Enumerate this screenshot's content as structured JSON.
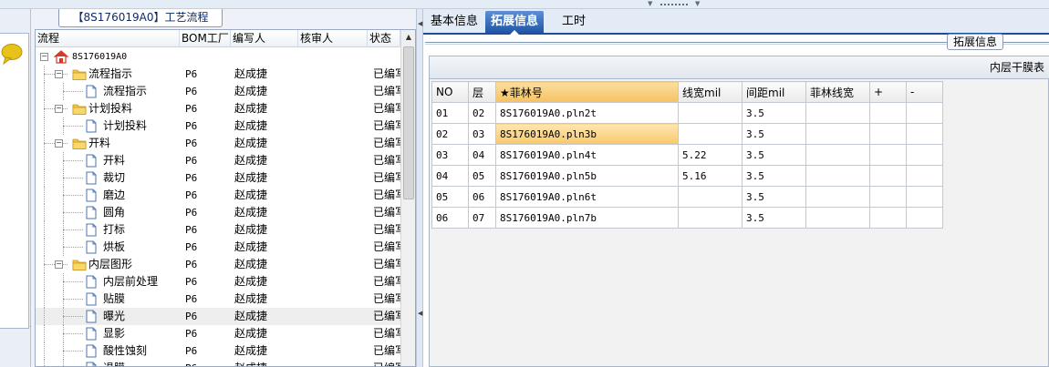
{
  "left_panel": {
    "tab_title": "【8S176019A0】工艺流程",
    "columns": {
      "flow": "流程",
      "bom": "BOM工厂",
      "writer": "编写人",
      "reviewer": "核审人",
      "status": "状态"
    },
    "rows": [
      {
        "depth": 0,
        "icon": "home-icon",
        "label": "8S176019A0",
        "bom": "",
        "writer": "",
        "status": "",
        "expander": "−"
      },
      {
        "depth": 1,
        "icon": "folder-icon",
        "label": "流程指示",
        "bom": "P6",
        "writer": "赵成捷",
        "status": "已编写",
        "expander": "−"
      },
      {
        "depth": 2,
        "icon": "document-icon",
        "label": "流程指示",
        "bom": "P6",
        "writer": "赵成捷",
        "status": "已编写"
      },
      {
        "depth": 1,
        "icon": "folder-icon",
        "label": "计划投料",
        "bom": "P6",
        "writer": "赵成捷",
        "status": "已编写",
        "expander": "−"
      },
      {
        "depth": 2,
        "icon": "document-icon",
        "label": "计划投料",
        "bom": "P6",
        "writer": "赵成捷",
        "status": "已编写"
      },
      {
        "depth": 1,
        "icon": "folder-icon",
        "label": "开料",
        "bom": "P6",
        "writer": "赵成捷",
        "status": "已编写",
        "expander": "−"
      },
      {
        "depth": 2,
        "icon": "document-icon",
        "label": "开料",
        "bom": "P6",
        "writer": "赵成捷",
        "status": "已编写"
      },
      {
        "depth": 2,
        "icon": "document-icon",
        "label": "裁切",
        "bom": "P6",
        "writer": "赵成捷",
        "status": "已编写"
      },
      {
        "depth": 2,
        "icon": "document-icon",
        "label": "磨边",
        "bom": "P6",
        "writer": "赵成捷",
        "status": "已编写"
      },
      {
        "depth": 2,
        "icon": "document-icon",
        "label": "圆角",
        "bom": "P6",
        "writer": "赵成捷",
        "status": "已编写"
      },
      {
        "depth": 2,
        "icon": "document-icon",
        "label": "打标",
        "bom": "P6",
        "writer": "赵成捷",
        "status": "已编写"
      },
      {
        "depth": 2,
        "icon": "document-icon",
        "label": "烘板",
        "bom": "P6",
        "writer": "赵成捷",
        "status": "已编写"
      },
      {
        "depth": 1,
        "icon": "folder-icon",
        "label": "内层图形",
        "bom": "P6",
        "writer": "赵成捷",
        "status": "已编写",
        "expander": "−"
      },
      {
        "depth": 2,
        "icon": "document-icon",
        "label": "内层前处理",
        "bom": "P6",
        "writer": "赵成捷",
        "status": "已编写"
      },
      {
        "depth": 2,
        "icon": "document-icon",
        "label": "贴膜",
        "bom": "P6",
        "writer": "赵成捷",
        "status": "已编写"
      },
      {
        "depth": 2,
        "icon": "document-icon",
        "label": "曝光",
        "bom": "P6",
        "writer": "赵成捷",
        "status": "已编写",
        "selected": true
      },
      {
        "depth": 2,
        "icon": "document-icon",
        "label": "显影",
        "bom": "P6",
        "writer": "赵成捷",
        "status": "已编写"
      },
      {
        "depth": 2,
        "icon": "document-icon",
        "label": "酸性蚀刻",
        "bom": "P6",
        "writer": "赵成捷",
        "status": "已编写"
      },
      {
        "depth": 2,
        "icon": "document-icon",
        "label": "退膜",
        "bom": "P6",
        "writer": "赵成捷",
        "status": "已编写"
      }
    ]
  },
  "right_panel": {
    "tabs": [
      {
        "label": "基本信息",
        "active": false
      },
      {
        "label": "拓展信息",
        "active": true
      },
      {
        "label": "工时",
        "active": false
      }
    ],
    "group_title": "拓展信息",
    "table_caption": "内层干膜表",
    "table_headers": [
      "NO",
      "层",
      "★菲林号",
      "线宽mil",
      "间距mil",
      "菲林线宽",
      "+",
      "-"
    ],
    "table_rows": [
      [
        "01",
        "02",
        "8S176019A0.pln2t",
        "",
        "3.5",
        "",
        "",
        ""
      ],
      [
        "02",
        "03",
        "8S176019A0.pln3b",
        "",
        "3.5",
        "",
        "",
        ""
      ],
      [
        "03",
        "04",
        "8S176019A0.pln4t",
        "5.22",
        "3.5",
        "",
        "",
        ""
      ],
      [
        "04",
        "05",
        "8S176019A0.pln5b",
        "5.16",
        "3.5",
        "",
        "",
        ""
      ],
      [
        "05",
        "06",
        "8S176019A0.pln6t",
        "",
        "3.5",
        "",
        "",
        ""
      ],
      [
        "06",
        "07",
        "8S176019A0.pln7b",
        "",
        "3.5",
        "",
        "",
        ""
      ]
    ],
    "selected_cell": {
      "row": 1,
      "col": 2
    }
  },
  "colors": {
    "accent_blue": "#1e56a8",
    "highlight_orange": "#f8c86a",
    "folder_yellow": "#f4c542",
    "home_red": "#d83a2a",
    "chat_yellow": "#e8c21a"
  }
}
